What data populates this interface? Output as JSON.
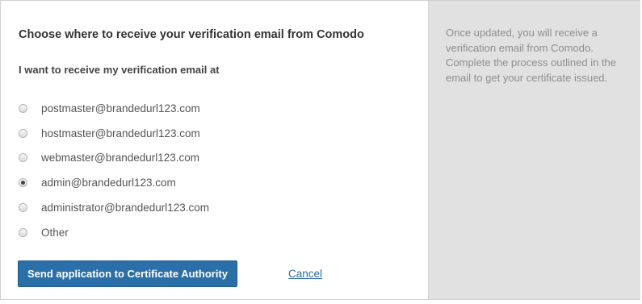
{
  "form": {
    "title": "Choose where to receive your verification email from Comodo",
    "subtitle": "I want to receive my verification email at",
    "options": [
      {
        "label": "postmaster@brandedurl123.com",
        "checked": false
      },
      {
        "label": "hostmaster@brandedurl123.com",
        "checked": false
      },
      {
        "label": "webmaster@brandedurl123.com",
        "checked": false
      },
      {
        "label": "admin@brandedurl123.com",
        "checked": true
      },
      {
        "label": "administrator@brandedurl123.com",
        "checked": false
      },
      {
        "label": "Other",
        "checked": false
      }
    ],
    "send_label": "Send application to Certificate Authority",
    "cancel_label": "Cancel"
  },
  "sidebar": {
    "info_text": "Once updated, you will receive a verification email from Comodo. Complete the process outlined in the email to get your certificate issued."
  },
  "colors": {
    "accent": "#2a6fa7",
    "sidebar_bg": "#e1e1e1"
  }
}
